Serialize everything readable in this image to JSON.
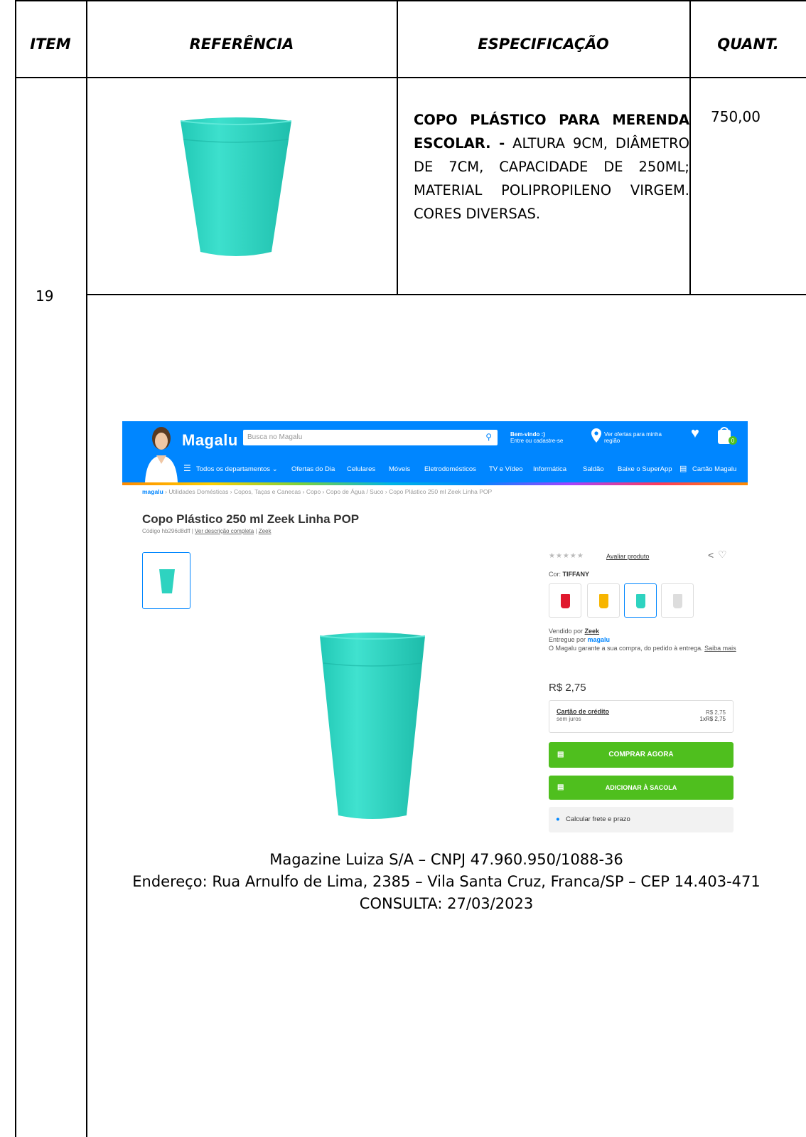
{
  "table": {
    "headers": {
      "item": "ITEM",
      "ref": "REFERÊNCIA",
      "spec": "ESPECIFICAÇÃO",
      "qty": "QUANT."
    },
    "item_number": "19",
    "spec_bold": "COPO PLÁSTICO PARA MERENDA ESCOLAR. -",
    "spec_text": " ALTURA 9CM, DIÂMETRO DE 7CM, CAPACIDADE DE 250ML; MATERIAL POLIPROPILENO VIRGEM. CORES DIVERSAS.",
    "quantity": "750,00"
  },
  "screenshot": {
    "logo": "Magalu",
    "search_placeholder": "Busca no Magalu",
    "welcome_title": "Bem-vindo :)",
    "welcome_sub": "Entre ou cadastre-se",
    "offers_line1": "Ver ofertas para minha",
    "offers_line2": "região",
    "cart_count": "0",
    "nav": [
      "Todos os departamentos",
      "Ofertas do Dia",
      "Celulares",
      "Móveis",
      "Eletrodomésticos",
      "TV e Vídeo",
      "Informática",
      "Saldão",
      "Baixe o SuperApp",
      "Cartão Magalu"
    ],
    "breadcrumb_logo": "magalu",
    "breadcrumb": " › Utilidades Domésticas › Copos, Taças e Canecas › Copo › Copo de Água / Suco › Copo Plástico 250 ml Zeek Linha POP",
    "product_title": "Copo Plástico 250 ml Zeek Linha POP",
    "product_code": "Código hb296d8dff | ",
    "desc_link": "Ver descrição completa",
    "brand_link": "Zeek",
    "rate_link": "Avaliar produto",
    "color_label": "Cor: ",
    "color_value": "TIFFANY",
    "swatch_colors": [
      "#e0182d",
      "#f7b500",
      "#2ed3c0",
      "#dddddd"
    ],
    "sold_by": "Vendido por ",
    "seller": "Zeek",
    "delivered_by": "Entregue por ",
    "delivered_logo": "magalu",
    "guarantee": "O Magalu garante a sua compra, do pedido à entrega. ",
    "learn_more": "Saiba mais",
    "price": "R$ 2,75",
    "card_label": "Cartão de crédito",
    "card_sub": "sem juros",
    "card_price": "R$ 2,75",
    "card_install": "1xR$ 2,75",
    "buy_now": "COMPRAR AGORA",
    "add_bag": "ADICIONAR À SACOLA",
    "calc_shipping": "Calcular frete e prazo"
  },
  "footer": {
    "line1": "Magazine Luiza S/A – CNPJ 47.960.950/1088-36",
    "line2": "Endereço: Rua Arnulfo de Lima, 2385 – Vila Santa Cruz, Franca/SP – CEP 14.403-471",
    "line3": "CONSULTA: 27/03/2023"
  },
  "colors": {
    "cup": "#2ed3c0",
    "brand_blue": "#0086ff",
    "buy_green": "#4fbf1e"
  }
}
